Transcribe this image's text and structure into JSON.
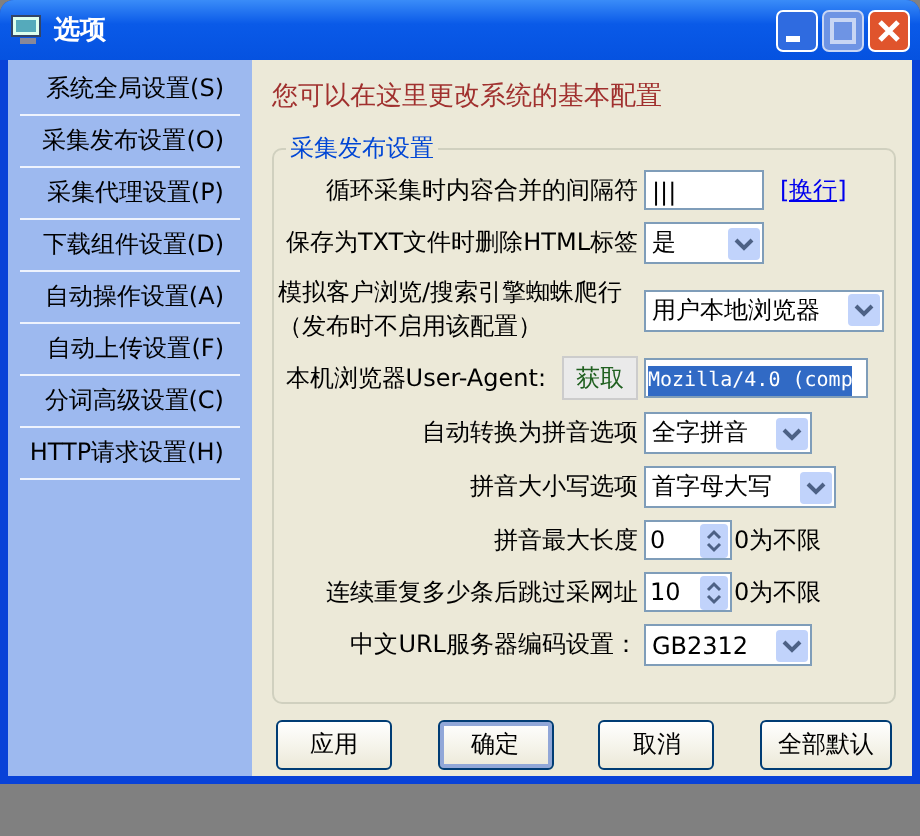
{
  "window": {
    "title": "选项"
  },
  "sidebar": {
    "items": [
      {
        "label": "系统全局设置(S)"
      },
      {
        "label": "采集发布设置(O)"
      },
      {
        "label": "采集代理设置(P)"
      },
      {
        "label": "下载组件设置(D)"
      },
      {
        "label": "自动操作设置(A)"
      },
      {
        "label": "自动上传设置(F)"
      },
      {
        "label": "分词高级设置(C)"
      },
      {
        "label": "HTTP请求设置(H)"
      }
    ]
  },
  "header": "您可以在这里更改系统的基本配置",
  "group": {
    "title": "采集发布设置",
    "rows": [
      {
        "kind": "text",
        "label": "循环采集时内容合并的间隔符",
        "value": "|||",
        "link": "[换行]"
      },
      {
        "kind": "select",
        "label": "保存为TXT文件时删除HTML标签",
        "value": "是"
      },
      {
        "kind": "select",
        "label_lines": [
          "模拟客户浏览/搜索引擎蜘蛛爬行",
          "（发布时不启用该配置）"
        ],
        "value": "用户本地浏览器"
      },
      {
        "kind": "agent",
        "label": "本机浏览器User-Agent:",
        "button": "获取",
        "value": "Mozilla/4.0 (comp",
        "selected": true
      },
      {
        "kind": "select",
        "label": "自动转换为拼音选项",
        "value": "全字拼音"
      },
      {
        "kind": "select",
        "label": "拼音大小写选项",
        "value": "首字母大写"
      },
      {
        "kind": "spinner",
        "label": "拼音最大长度",
        "value": "0",
        "suffix": "0为不限"
      },
      {
        "kind": "spinner",
        "label": "连续重复多少条后跳过采网址",
        "value": "10",
        "suffix": "0为不限"
      },
      {
        "kind": "select",
        "label": "中文URL服务器编码设置：",
        "value": "GB2312"
      }
    ]
  },
  "buttons": [
    {
      "label": "应用",
      "default": false
    },
    {
      "label": "确定",
      "default": true
    },
    {
      "label": "取消",
      "default": false
    },
    {
      "label": "全部默认",
      "default": false
    }
  ]
}
